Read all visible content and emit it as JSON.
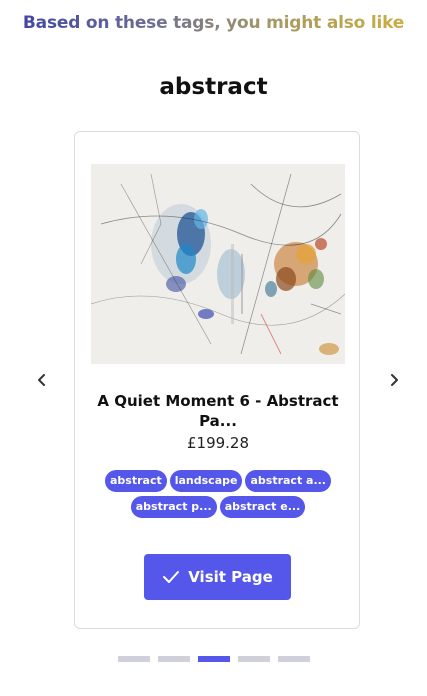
{
  "header": {
    "headline": "Based on these tags, you might also like",
    "tag_title": "abstract"
  },
  "product": {
    "title_line1": "A Quiet Moment 6 - Abstract",
    "title_line2": "Pa...",
    "price": "£199.28",
    "tags": [
      "abstract",
      "landscape",
      "abstract a...",
      "abstract p...",
      "abstract e..."
    ],
    "visit_label": "Visit Page"
  },
  "carousel": {
    "slide_count": 5,
    "active_slide": 3
  },
  "colors": {
    "accent": "#5457ea",
    "dot_inactive": "#cfd0da"
  },
  "icons": {
    "prev": "chevron-left-icon",
    "next": "chevron-right-icon",
    "visit": "checkmark-icon"
  }
}
